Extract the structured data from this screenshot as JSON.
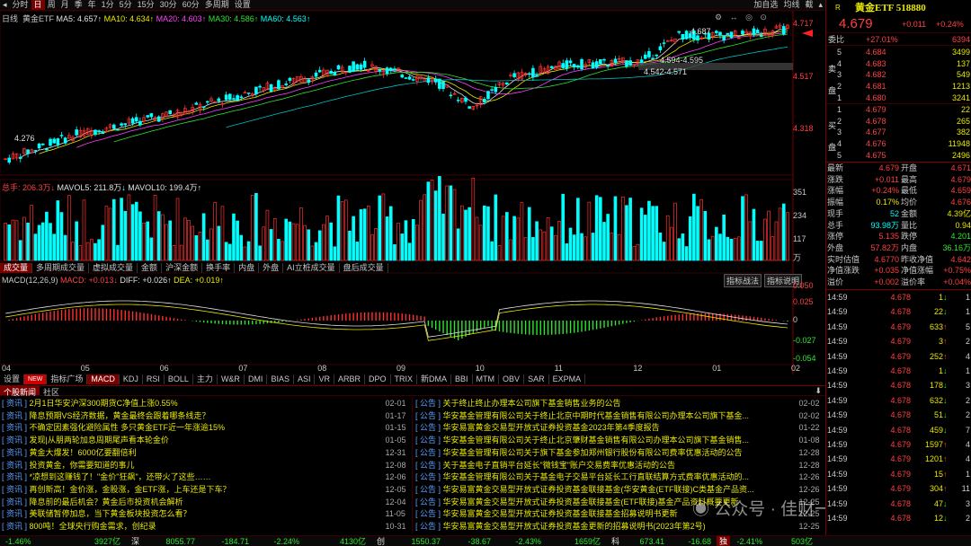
{
  "toolbar": {
    "items": [
      "分时",
      "日",
      "周",
      "月",
      "季",
      "年",
      "1分",
      "5分",
      "15分",
      "30分",
      "60分",
      "多周期",
      "设置"
    ],
    "selected": "日",
    "right": [
      "加自选",
      "均线",
      "截"
    ]
  },
  "ma_legend": {
    "period": "日线",
    "name": "黄金ETF",
    "ma5": "MA5: 4.657↑",
    "ma10": "MA10: 4.634↑",
    "ma20": "MA20: 4.603↑",
    "ma30": "MA30: 4.586↑",
    "ma60": "MA60: 4.563↑"
  },
  "price_axis": [
    "4.717",
    "4.517",
    "4.318"
  ],
  "price_labels": {
    "high": "4.687",
    "low": "4.276",
    "range1": "4.594-4.595",
    "range2": "4.542-4.571",
    "last": "4.679"
  },
  "vol_legend": {
    "total": "总手: 206.3万↓",
    "mavol5": "MAVOL5: 211.8万↓",
    "mavol10": "MAVOL10: 199.4万↑"
  },
  "vol_axis": [
    "351",
    "234",
    "117",
    "万"
  ],
  "mid_tabs": [
    "成交量",
    "多周期成交量",
    "虚拟成交量",
    "金额",
    "沪深金额",
    "换手率",
    "内盘",
    "外盘",
    "AI立桩成交量",
    "盘后成交量"
  ],
  "mid_tabs_selected": "成交量",
  "macd_legend": {
    "name": "MACD(12,26,9)",
    "macd": "MACD: +0.013↓",
    "diff": "DIFF: +0.026↑",
    "dea": "DEA: +0.019↑"
  },
  "macd_buttons": [
    "指标战法",
    "指标说明"
  ],
  "macd_axis": [
    "0.050",
    "0.025",
    "0",
    "-0.027",
    "-0.054"
  ],
  "months": [
    "04",
    "05",
    "06",
    "07",
    "08",
    "09",
    "10",
    "11",
    "12",
    "01",
    "02"
  ],
  "ind_tabs": [
    "设置",
    "NEW",
    "指标广场",
    "MACD",
    "KDJ",
    "RSI",
    "BOLL",
    "主力",
    "W&R",
    "DMI",
    "BIAS",
    "ASI",
    "VR",
    "ARBR",
    "DPO",
    "TRIX",
    "新DMA",
    "BBI",
    "MTM",
    "OBV",
    "SAR",
    "EXPMA"
  ],
  "ind_selected": "MACD",
  "news_tabs": [
    "个股新闻",
    "社区"
  ],
  "news_left": [
    {
      "tag": "资讯",
      "title": "2月1日华安沪深300期货C净值上涨0.55%",
      "date": "02-01"
    },
    {
      "tag": "资讯",
      "title": "降息预期VS经济数据，黄金最终会跟着哪条线走？",
      "date": "01-17"
    },
    {
      "tag": "资讯",
      "title": "不确定因素强化避险属性 多只黄金ETF近一年涨逾15%",
      "date": "01-15"
    },
    {
      "tag": "资讯",
      "title": "发现|从朋两轮加息周期尾声看本轮金价",
      "date": "01-05"
    },
    {
      "tag": "资讯",
      "title": "黄金大爆发！6000亿要翻倍利",
      "date": "12-31"
    },
    {
      "tag": "资讯",
      "title": "投资黄金，你需要知道的事儿",
      "date": "12-08"
    },
    {
      "tag": "资讯",
      "title": "*凉想到这赚钱了！\"金价\"狂飙\"，还带火了这些……",
      "date": "12-06"
    },
    {
      "tag": "资讯",
      "title": "再创新高！金价涨，金股涨，金ETF涨，上车还是下车？",
      "date": "12-05"
    },
    {
      "tag": "资讯",
      "title": "降息前的最后机会？黄金后市投资机会解析",
      "date": "12-04"
    },
    {
      "tag": "资讯",
      "title": "美联储暂停加息，当下黄金板块投资怎么看？",
      "date": "11-05"
    },
    {
      "tag": "资讯",
      "title": "800吨！全球央行购金需求，创纪录",
      "date": "10-31"
    }
  ],
  "news_right": [
    {
      "tag": "公告",
      "title": "关于终止终止办理本公司旗下基金销售业务的公告",
      "date": "02-02"
    },
    {
      "tag": "公告",
      "title": "华安基金管理有限公司关于终止北京中期时代基金销售有限公司办理本公司旗下基金...",
      "date": "02-02"
    },
    {
      "tag": "公告",
      "title": "华安易富黄金交易型开放式证券投资基金2023年第4季度报告",
      "date": "01-22"
    },
    {
      "tag": "公告",
      "title": "华安基金管理有限公司关于终止北京肇财基金销售有限公司办理本公司旗下基金销售...",
      "date": "01-08"
    },
    {
      "tag": "公告",
      "title": "华安基金管理有限公司关于旗下基金参加郑州银行股份有限公司费率优惠活动的公告",
      "date": "12-28"
    },
    {
      "tag": "公告",
      "title": "关于基金电子直销平台延长\"微钱宝\"账户交易费率优惠活动的公告",
      "date": "12-28"
    },
    {
      "tag": "公告",
      "title": "华安基金管理有限公司关于基金电子交易平台延长工行直联结算方式费率优惠活动的...",
      "date": "12-26"
    },
    {
      "tag": "公告",
      "title": "华安易富黄金交易型开放式证券投资基金联接基金(华安黄金(ETF联接)C类基金产品资...",
      "date": "12-26"
    },
    {
      "tag": "公告",
      "title": "华安易富黄金交易型开放式证券投资基金联接基金(ETF联接)基金产品资料概要更新",
      "date": "12-25"
    },
    {
      "tag": "公告",
      "title": "华安易富黄金交易型开放式证券投资基金联接基金招募说明书更新",
      "date": "12-25"
    },
    {
      "tag": "公告",
      "title": "华安易富黄金交易型开放式证券投资基金更新的招募说明书(2023年第2号)",
      "date": "12-25"
    }
  ],
  "quote": {
    "code_tag": "R",
    "title": "黄金ETF 518880",
    "price": "4.679",
    "change": "+0.011",
    "pct": "+0.24%",
    "wb_label": "委比",
    "wb": "+27.01%",
    "wc": "6394"
  },
  "asks": [
    {
      "lvl": "5",
      "p": "4.684",
      "v": "3499"
    },
    {
      "lvl": "4",
      "p": "4.683",
      "v": "137"
    },
    {
      "lvl": "3",
      "p": "4.682",
      "v": "549"
    },
    {
      "lvl": "2",
      "p": "4.681",
      "v": "1213"
    },
    {
      "lvl": "1",
      "p": "4.680",
      "v": "3241"
    }
  ],
  "bids": [
    {
      "lvl": "1",
      "p": "4.679",
      "v": "22"
    },
    {
      "lvl": "2",
      "p": "4.678",
      "v": "265"
    },
    {
      "lvl": "3",
      "p": "4.677",
      "v": "382"
    },
    {
      "lvl": "4",
      "p": "4.676",
      "v": "11948"
    },
    {
      "lvl": "5",
      "p": "4.675",
      "v": "2496"
    }
  ],
  "ask_side": [
    "卖",
    "盘"
  ],
  "bid_side": [
    "买",
    "盘"
  ],
  "stats": [
    {
      "l1": "最新",
      "v1": "4.679",
      "l2": "开盘",
      "v2": "4.671"
    },
    {
      "l1": "涨跌",
      "v1": "+0.011",
      "l2": "最高",
      "v2": "4.679"
    },
    {
      "l1": "涨幅",
      "v1": "+0.24%",
      "l2": "最低",
      "v2": "4.659"
    },
    {
      "l1": "振幅",
      "v1": "0.17%",
      "l2": "均价",
      "v2": "4.676"
    },
    {
      "l1": "现手",
      "v1": "52",
      "l2": "金额",
      "v2": "4.39亿"
    },
    {
      "l1": "总手",
      "v1": "93.98万",
      "l2": "量比",
      "v2": "0.94"
    },
    {
      "l1": "涨停",
      "v1": "5.135",
      "l2": "跌停",
      "v2": "4.201"
    },
    {
      "l1": "外盘",
      "v1": "57.82万",
      "l2": "内盘",
      "v2": "36.16万"
    },
    {
      "l1": "实时估值",
      "v1": "4.6770",
      "l2": "昨收净值",
      "v2": "4.642"
    },
    {
      "l1": "净值涨跌",
      "v1": "+0.035",
      "l2": "净值涨幅",
      "v2": "+0.75%"
    },
    {
      "l1": "溢价",
      "v1": "+0.002",
      "l2": "溢价率",
      "v2": "+0.04%"
    }
  ],
  "ticks": [
    {
      "t": "14:59",
      "p": "4.678",
      "v": "1",
      "d": "down",
      "n": "1"
    },
    {
      "t": "14:59",
      "p": "4.678",
      "v": "22",
      "d": "down",
      "n": "1"
    },
    {
      "t": "14:59",
      "p": "4.679",
      "v": "633",
      "d": "up",
      "n": "5"
    },
    {
      "t": "14:59",
      "p": "4.679",
      "v": "3",
      "d": "up",
      "n": "2"
    },
    {
      "t": "14:59",
      "p": "4.679",
      "v": "252",
      "d": "up",
      "n": "4"
    },
    {
      "t": "14:59",
      "p": "4.678",
      "v": "1",
      "d": "down",
      "n": "1"
    },
    {
      "t": "14:59",
      "p": "4.678",
      "v": "178",
      "d": "down",
      "n": "3"
    },
    {
      "t": "14:59",
      "p": "4.678",
      "v": "632",
      "d": "down",
      "n": "2"
    },
    {
      "t": "14:59",
      "p": "4.678",
      "v": "51",
      "d": "down",
      "n": "2"
    },
    {
      "t": "14:59",
      "p": "4.678",
      "v": "459",
      "d": "down",
      "n": "7"
    },
    {
      "t": "14:59",
      "p": "4.679",
      "v": "1597",
      "d": "up",
      "n": "4"
    },
    {
      "t": "14:59",
      "p": "4.679",
      "v": "1201",
      "d": "up",
      "n": "4"
    },
    {
      "t": "14:59",
      "p": "4.679",
      "v": "15",
      "d": "up",
      "n": "1"
    },
    {
      "t": "14:59",
      "p": "4.679",
      "v": "304",
      "d": "up",
      "n": "11"
    },
    {
      "t": "14:59",
      "p": "4.678",
      "v": "47",
      "d": "down",
      "n": "3"
    },
    {
      "t": "14:59",
      "p": "4.678",
      "v": "12",
      "d": "down",
      "n": "2"
    }
  ],
  "bottom": {
    "sh_pct": "-1.46%",
    "sh_amt": "3927亿",
    "sz_label": "深",
    "sz_val": "8055.77",
    "sz_chg": "-184.71",
    "sz_pct": "-2.24%",
    "sz_amt": "4130亿",
    "cy_label": "创",
    "cy_val": "1550.37",
    "cy_chg": "-38.67",
    "cy_pct": "-2.43%",
    "cy_amt": "1659亿",
    "kc_label": "科",
    "kc_val": "673.41",
    "kc_chg": "-16.68",
    "tab_label": "独",
    "kc_pct": "-2.41%",
    "kc_amt": "503亿"
  },
  "watermark": "公众号 · 佳财一分钟"
}
